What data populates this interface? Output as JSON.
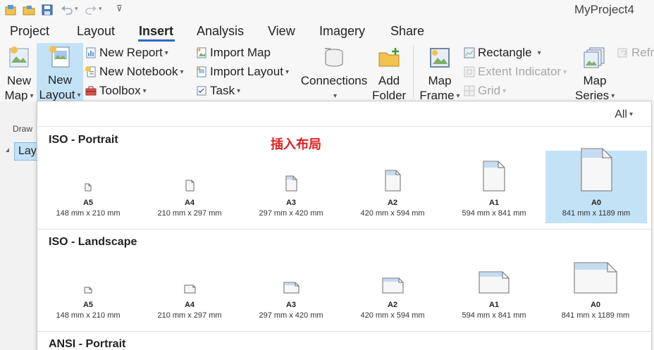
{
  "window": {
    "title": "MyProject4"
  },
  "tabs": [
    "Project",
    "Layout",
    "Insert",
    "Analysis",
    "View",
    "Imagery",
    "Share"
  ],
  "active_tab": "Insert",
  "ribbon": {
    "new_map": {
      "line1": "New",
      "line2": "Map"
    },
    "new_layout": {
      "line1": "New",
      "line2": "Layout"
    },
    "new_report": "New Report",
    "new_notebook": "New Notebook",
    "toolbox": "Toolbox",
    "import_map": "Import Map",
    "import_layout": "Import Layout",
    "task": "Task",
    "connections": "Connections",
    "add_folder": {
      "line1": "Add",
      "line2": "Folder"
    },
    "map_frame": {
      "line1": "Map",
      "line2": "Frame"
    },
    "rectangle": "Rectangle",
    "extent_indicator": "Extent Indicator",
    "grid": "Grid",
    "map_series": {
      "line1": "Map",
      "line2": "Series"
    },
    "refresh": "Refr"
  },
  "left_pane": {
    "drawing_label": "Draw",
    "layout_item": "Lay"
  },
  "gallery": {
    "filter": "All",
    "annotation": "插入布局",
    "sections": [
      {
        "title": "ISO - Portrait",
        "items": [
          {
            "name": "A5",
            "size": "148 mm x 210 mm"
          },
          {
            "name": "A4",
            "size": "210 mm x 297 mm"
          },
          {
            "name": "A3",
            "size": "297 mm x 420 mm"
          },
          {
            "name": "A2",
            "size": "420 mm x 594 mm"
          },
          {
            "name": "A1",
            "size": "594 mm x 841 mm"
          },
          {
            "name": "A0",
            "size": "841 mm x 1189 mm"
          }
        ]
      },
      {
        "title": "ISO - Landscape",
        "items": [
          {
            "name": "A5",
            "size": "148 mm x 210 mm"
          },
          {
            "name": "A4",
            "size": "210 mm x 297 mm"
          },
          {
            "name": "A3",
            "size": "297 mm x 420 mm"
          },
          {
            "name": "A2",
            "size": "420 mm x 594 mm"
          },
          {
            "name": "A1",
            "size": "594 mm x 841 mm"
          },
          {
            "name": "A0",
            "size": "841 mm x 1189 mm"
          }
        ]
      },
      {
        "title": "ANSI - Portrait"
      }
    ],
    "selected_item": "A0"
  },
  "icons": {
    "save": "save-icon",
    "open": "open-folder-icon",
    "new_project": "new-project-icon",
    "undo": "undo-icon",
    "redo": "redo-icon",
    "customize": "customize-qat-icon",
    "accent": "#c4e2f6",
    "annotation_color": "#e02020"
  }
}
